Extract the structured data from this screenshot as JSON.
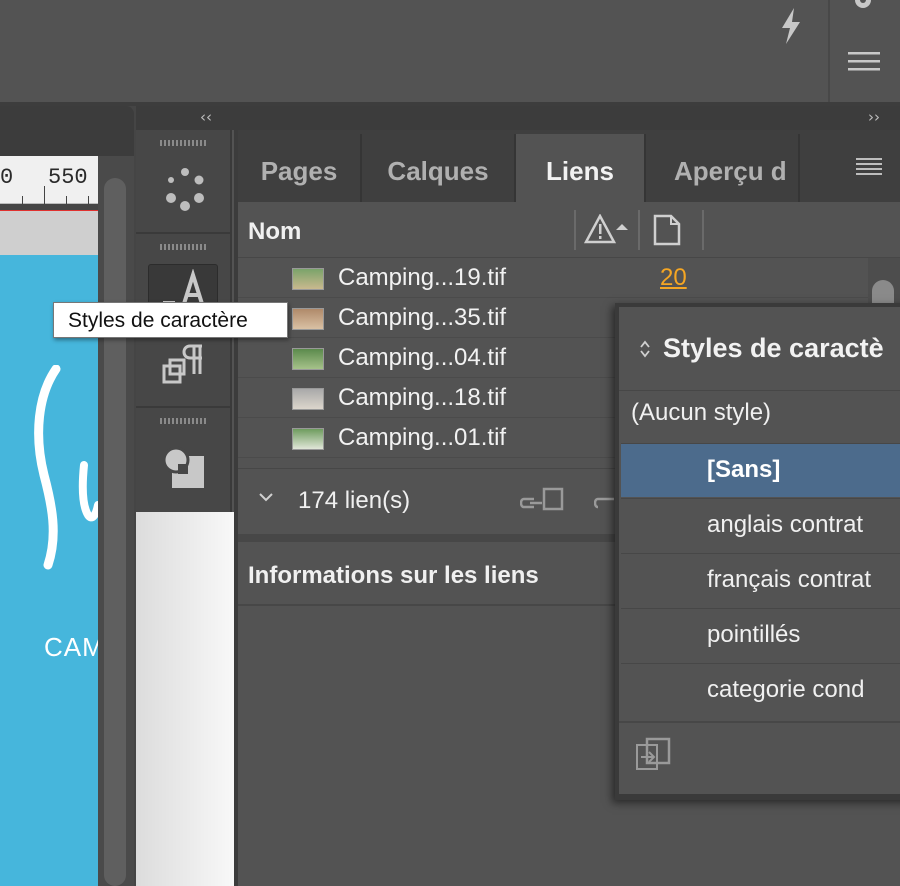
{
  "ruler": {
    "mark_prev": "0",
    "mark_550": "550"
  },
  "document": {
    "visible_text": "CAM"
  },
  "tooltip": {
    "text": "Styles de caractère"
  },
  "panel_tabs": [
    {
      "label": "Pages",
      "active": false
    },
    {
      "label": "Calques",
      "active": false
    },
    {
      "label": "Liens",
      "active": true
    },
    {
      "label": "Aperçu d",
      "active": false
    }
  ],
  "links_panel": {
    "column_name": "Nom",
    "rows": [
      {
        "name": "Camping...19.tif",
        "page": "20"
      },
      {
        "name": "Camping...35.tif",
        "page": ""
      },
      {
        "name": "Camping...04.tif",
        "page": ""
      },
      {
        "name": "Camping...18.tif",
        "page": ""
      },
      {
        "name": "Camping...01.tif",
        "page": ""
      }
    ],
    "count": "174 lien(s)",
    "info_title": "Informations sur les liens"
  },
  "character_styles": {
    "title": "Styles de caractè",
    "none_label": "(Aucun style)",
    "items": [
      {
        "label": "[Sans]",
        "selected": true
      },
      {
        "label": "anglais contrat",
        "selected": false
      },
      {
        "label": "français contrat",
        "selected": false
      },
      {
        "label": "pointillés",
        "selected": false
      },
      {
        "label": "categorie cond",
        "selected": false
      }
    ]
  },
  "colors": {
    "accent_selected": "#4c6b8c",
    "page_link": "#f5a623",
    "document_page": "#46b6dc"
  },
  "icons": [
    "lightning-icon",
    "gear-icon",
    "hamburger-menu-icon",
    "collapse-left-icon",
    "expand-right-icon",
    "spinner-dots-icon",
    "character-styles-icon",
    "paragraph-styles-icon",
    "shape-icon",
    "panel-menu-icon",
    "warning-sort-icon",
    "page-icon",
    "chevron-down-icon",
    "relink-icon",
    "goto-link-icon",
    "up-down-icon",
    "new-style-icon"
  ]
}
